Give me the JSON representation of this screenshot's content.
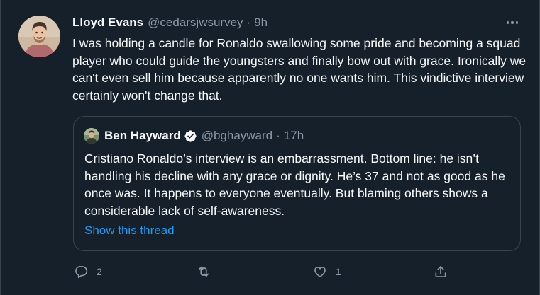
{
  "tweet": {
    "author_name": "Lloyd Evans",
    "author_handle": "@cedarsjwsurvey",
    "separator": "·",
    "time": "9h",
    "text": "I was holding a candle for Ronaldo swallowing some pride and becoming a squad player who could guide the youngsters and finally bow out with grace. Ironically we can't even sell him because apparently no one wants him. This vindictive interview certainly won't change that."
  },
  "quote": {
    "author_name": "Ben Hayward",
    "author_handle": "@bghayward",
    "separator": "·",
    "time": "17h",
    "text": "Cristiano Ronaldo’s interview is an embarrassment. Bottom line: he isn’t handling his decline with any grace or dignity. He’s 37 and not as good as he once was. It happens to everyone eventually. But blaming others shows a considerable lack of self-awareness.",
    "show_thread_label": "Show this thread"
  },
  "actions": {
    "reply_count": "2",
    "retweet_count": "",
    "like_count": "1"
  },
  "icons": {
    "more": "more-horizontal-icon",
    "verified": "verified-badge-icon",
    "reply": "reply-icon",
    "retweet": "retweet-icon",
    "like": "heart-icon",
    "share": "share-icon"
  },
  "colors": {
    "background": "#15202b",
    "text_primary": "#f7f9f9",
    "text_secondary": "#8b98a5",
    "border": "#38444d",
    "accent": "#1d9bf0"
  }
}
